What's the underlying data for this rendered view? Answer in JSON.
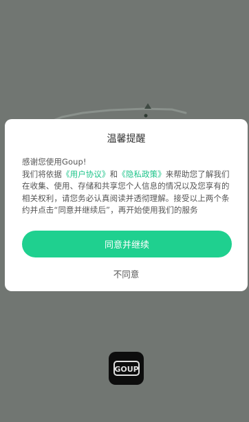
{
  "dialog": {
    "title": "温馨提醒",
    "greeting": "感谢您使用Goup!",
    "text_before_links": "我们将依据",
    "user_agreement_link": "《用户协议》",
    "conjunction": "和",
    "privacy_policy_link": "《隐私政策》",
    "text_after_links": "来帮助您了解我们在收集、使用、存储和共享您个人信息的情况以及您享有的相关权利，请您务必认真阅读并透彻理解。接受以上两个条约并点击“同意并继续后”，再开始使用我们的服务",
    "agree_label": "同意并继续",
    "disagree_label": "不同意"
  },
  "brand": {
    "logo_text": "GOUP"
  },
  "colors": {
    "overlay": "#717672",
    "accent": "#1fd08f",
    "link": "#1ec48a"
  }
}
